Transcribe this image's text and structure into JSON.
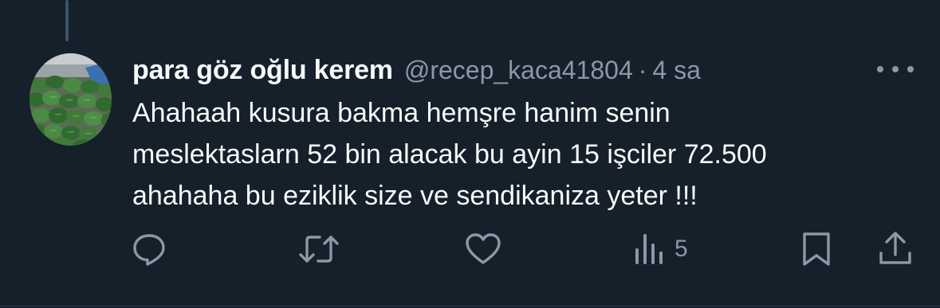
{
  "author": {
    "display_name": "para göz oğlu kerem",
    "handle": "@recep_kaca41804",
    "separator": "·",
    "time": "4 sa",
    "avatar_icon": "watermelon-pile-avatar"
  },
  "tweet": {
    "lines": [
      "Ahahaah kusura bakma hemşre hanim senin",
      "meslektaslarn 52 bin alacak bu ayin 15 işciler 72.500",
      "ahahaha bu eziklik size ve sendikaniza yeter !!!"
    ]
  },
  "actions": {
    "reply_icon": "reply-bubble-icon",
    "retweet_icon": "retweet-icon",
    "like_icon": "heart-icon",
    "views_icon": "views-bar-chart-icon",
    "views_count": "5",
    "bookmark_icon": "bookmark-icon",
    "share_icon": "share-upload-icon"
  },
  "colors": {
    "background": "#15202b",
    "primary_text": "#f7f9f9",
    "secondary_text": "#8b98a5",
    "thread_line": "#3d5466"
  }
}
